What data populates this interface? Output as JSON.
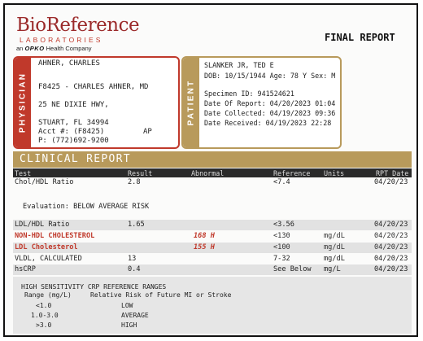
{
  "header": {
    "logo_main": "BioReference",
    "logo_sub": "LABORATORIES",
    "logo_tag_prefix": "an",
    "logo_tag_brand": "OPKO",
    "logo_tag_suffix": "Health Company",
    "report_title": "FINAL REPORT"
  },
  "physician": {
    "side_label": "PHYSICIAN",
    "name": "AHNER, CHARLES",
    "code_line": "F8425 - CHARLES AHNER, MD",
    "address1": "25 NE DIXIE HWY,",
    "address2": "STUART, FL 34994",
    "acct": "Acct #: (F8425)",
    "acct_flag": "AP",
    "phone": "P: (772)692-9200"
  },
  "patient": {
    "side_label": "PATIENT",
    "name": "SLANKER JR, TED E",
    "dob_line": "DOB: 10/15/1944 Age: 78 Y Sex: M",
    "specimen": "Specimen ID: 941524621",
    "date_of_report": "Date Of Report: 04/20/2023 01:04",
    "date_collected": "Date Collected: 04/19/2023 09:36",
    "date_received": "Date Received:  04/19/2023 22:28"
  },
  "clinical_report": {
    "title": "CLINICAL REPORT",
    "columns": {
      "test": "Test",
      "result": "Result",
      "abnormal": "Abnormal",
      "reference": "Reference",
      "units": "Units",
      "rpt_date": "RPT Date"
    },
    "rows": [
      {
        "test": "Chol/HDL Ratio",
        "result": "2.8",
        "abnormal": "",
        "reference": "<7.4",
        "units": "",
        "date": "04/20/23"
      },
      {
        "test": "LDL/HDL Ratio",
        "result": "1.65",
        "abnormal": "",
        "reference": "<3.56",
        "units": "",
        "date": "04/20/23"
      },
      {
        "test": "NON-HDL CHOLESTEROL",
        "result": "",
        "abnormal": "168 H",
        "reference": "<130",
        "units": "mg/dL",
        "date": "04/20/23"
      },
      {
        "test": "LDL Cholesterol",
        "result": "",
        "abnormal": "155 H",
        "reference": "<100",
        "units": "mg/dL",
        "date": "04/20/23"
      },
      {
        "test": "VLDL, CALCULATED",
        "result": "13",
        "abnormal": "",
        "reference": "7-32",
        "units": "mg/dL",
        "date": "04/20/23"
      },
      {
        "test": "hsCRP",
        "result": "0.4",
        "abnormal": "",
        "reference": "See Below",
        "units": "mg/L",
        "date": "04/20/23"
      }
    ],
    "evaluation": "Evaluation: BELOW AVERAGE RISK",
    "hs_title": "HIGH SENSITIVITY CRP REFERENCE RANGES",
    "hs_header_range": "Range (mg/L)",
    "hs_header_risk": "Relative Risk of Future MI or Stroke",
    "hs_ranges": [
      {
        "range": "<1.0",
        "risk": "LOW"
      },
      {
        "range": "1.0-3.0",
        "risk": "AVERAGE"
      },
      {
        "range": ">3.0",
        "risk": "HIGH"
      }
    ]
  }
}
